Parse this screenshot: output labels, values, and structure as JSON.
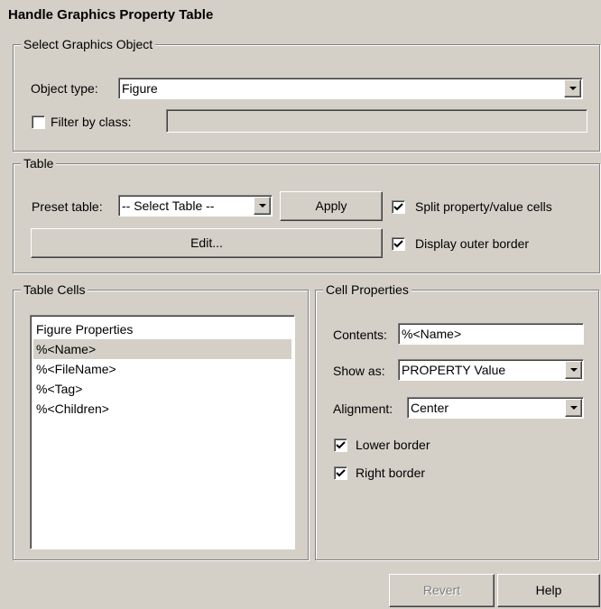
{
  "window_title": "Handle Graphics Property Table",
  "select_object": {
    "legend": "Select Graphics Object",
    "object_type_label": "Object type:",
    "object_type_value": "Figure",
    "filter_label": "Filter by class:",
    "filter_checked": false,
    "filter_value": ""
  },
  "table": {
    "legend": "Table",
    "preset_label": "Preset table:",
    "preset_value": "-- Select Table --",
    "apply_label": "Apply",
    "edit_label": "Edit...",
    "split_label": "Split property/value cells",
    "split_checked": true,
    "outer_border_label": "Display outer border",
    "outer_border_checked": true
  },
  "table_cells": {
    "legend": "Table Cells",
    "items": [
      "Figure Properties",
      "%<Name>",
      "%<FileName>",
      "%<Tag>",
      "%<Children>"
    ],
    "selected_index": 1
  },
  "cell_properties": {
    "legend": "Cell Properties",
    "contents_label": "Contents:",
    "contents_value": "%<Name>",
    "show_as_label": "Show as:",
    "show_as_value": "PROPERTY Value",
    "alignment_label": "Alignment:",
    "alignment_value": "Center",
    "lower_border_label": "Lower border",
    "lower_border_checked": true,
    "right_border_label": "Right border",
    "right_border_checked": true
  },
  "footer": {
    "revert_label": "Revert",
    "help_label": "Help"
  }
}
